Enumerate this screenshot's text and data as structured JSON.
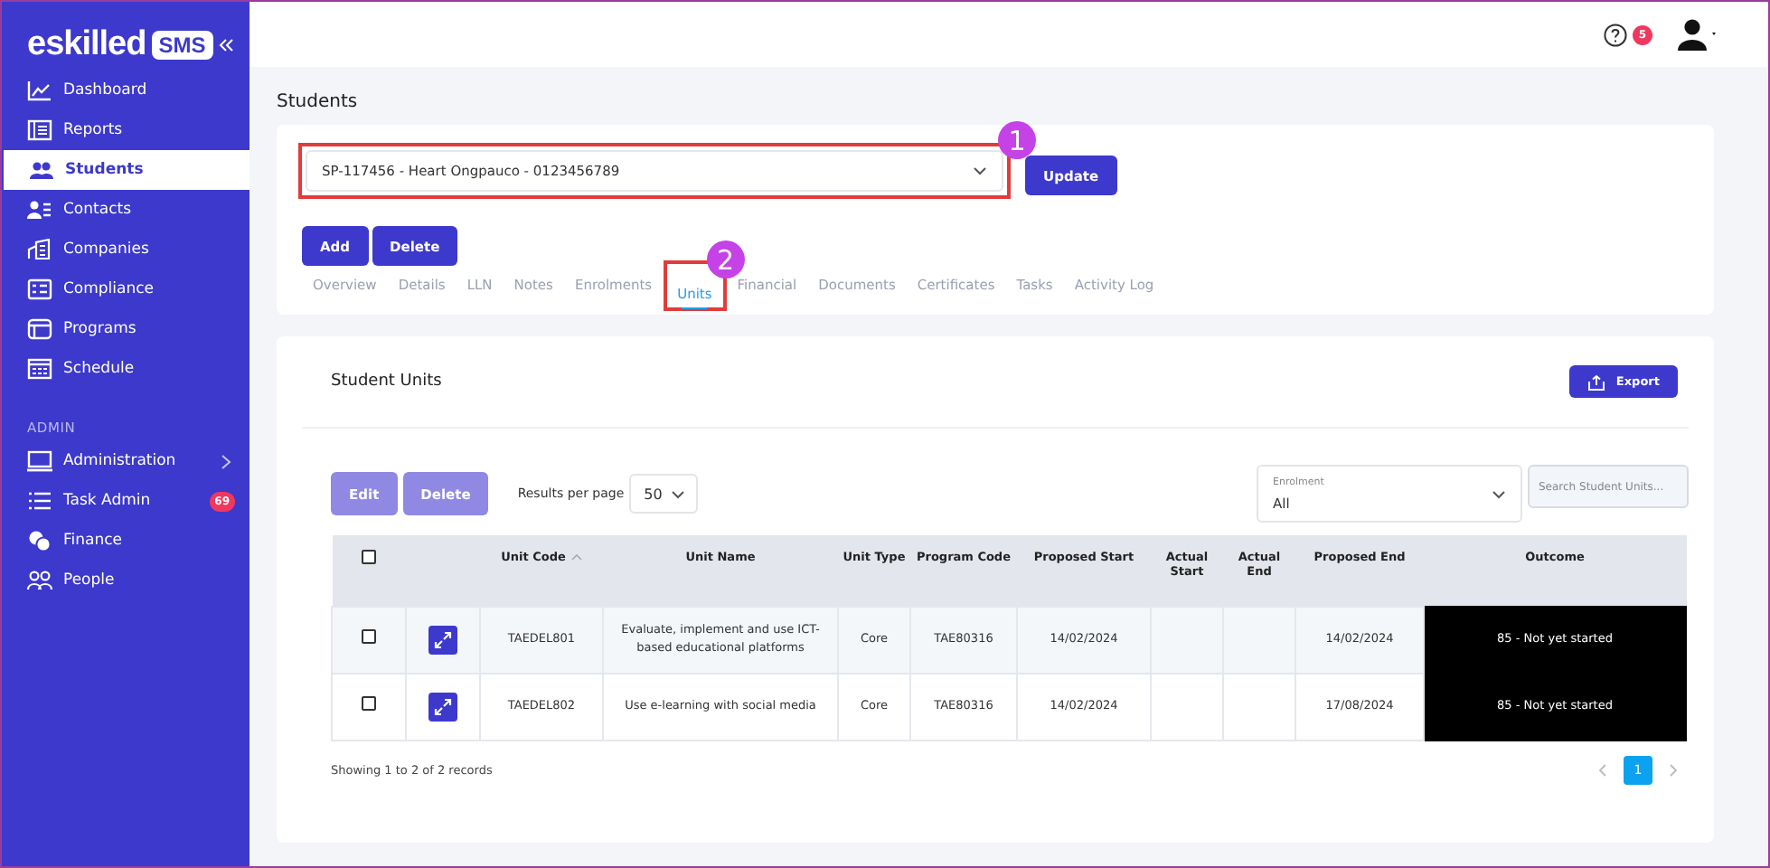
{
  "brand": {
    "name": "eskilled",
    "badge": "SMS"
  },
  "sidebar": {
    "items": [
      {
        "label": "Dashboard",
        "selected": false
      },
      {
        "label": "Reports",
        "selected": false
      },
      {
        "label": "Students",
        "selected": true
      },
      {
        "label": "Contacts",
        "selected": false
      },
      {
        "label": "Companies",
        "selected": false
      },
      {
        "label": "Compliance",
        "selected": false
      },
      {
        "label": "Programs",
        "selected": false
      },
      {
        "label": "Schedule",
        "selected": false
      }
    ],
    "section": "ADMIN",
    "admin_items": [
      {
        "label": "Administration",
        "selected": false,
        "submenu": true
      },
      {
        "label": "Task Admin",
        "selected": false,
        "submenu": false,
        "badge": "69"
      },
      {
        "label": "Finance",
        "selected": false,
        "submenu": false
      },
      {
        "label": "People",
        "selected": false,
        "submenu": false
      }
    ]
  },
  "topbar": {
    "notifications": "5"
  },
  "page_title": "Students",
  "student_selector": {
    "value": "SP-117456 - Heart Ongpauco - 0123456789",
    "callout": "1"
  },
  "update_button": "Update",
  "actions": [
    "Add",
    "Delete"
  ],
  "tabs": [
    {
      "label": "Overview",
      "selected": false
    },
    {
      "label": "Details",
      "selected": false
    },
    {
      "label": "LLN",
      "selected": false
    },
    {
      "label": "Notes",
      "selected": false
    },
    {
      "label": "Enrolments",
      "selected": false
    },
    {
      "label": "Units",
      "selected": true,
      "callout": "2"
    },
    {
      "label": "Financial",
      "selected": false
    },
    {
      "label": "Documents",
      "selected": false
    },
    {
      "label": "Certificates",
      "selected": false
    },
    {
      "label": "Tasks",
      "selected": false
    },
    {
      "label": "Activity Log",
      "selected": false
    }
  ],
  "units_panel": {
    "title": "Student Units",
    "export_button": "Export",
    "actions": [
      {
        "label": "Edit",
        "disabled": true
      },
      {
        "label": "Delete",
        "disabled": true
      }
    ],
    "results_per_page": {
      "label": "Results per page",
      "value": "50"
    },
    "enrolment_filter": {
      "label": "Enrolment",
      "value": "All"
    },
    "search": {
      "placeholder": "Search Student Units..."
    },
    "table": {
      "select_all": {
        "checked": false
      },
      "columns": [
        {
          "label": "Unit Code",
          "sorted": true
        },
        {
          "label": "Unit Name",
          "sorted": false
        },
        {
          "label": "Unit Type",
          "sorted": false
        },
        {
          "label": "Program Code",
          "sorted": false
        },
        {
          "label": "Proposed Start",
          "sorted": false
        },
        {
          "label": "Actual Start",
          "sorted": false
        },
        {
          "label": "Actual End",
          "sorted": false
        },
        {
          "label": "Proposed End",
          "sorted": false
        },
        {
          "label": "Outcome",
          "sorted": false
        }
      ],
      "rows": [
        {
          "checked": false,
          "unit_code": "TAEDEL801",
          "unit_name": "Evaluate, implement and use ICT-based educational platforms",
          "unit_type": "Core",
          "program_code": "TAE80316",
          "proposed_start": "14/02/2024",
          "proposed_end": "14/02/2024",
          "outcome": "85 - Not yet started"
        },
        {
          "checked": false,
          "unit_code": "TAEDEL802",
          "unit_name": "Use e-learning with social media",
          "unit_type": "Core",
          "program_code": "TAE80316",
          "proposed_start": "14/02/2024",
          "proposed_end": "17/08/2024",
          "outcome": "85 - Not yet started"
        }
      ]
    },
    "footer": "Showing 1 to 2 of 2 records",
    "pages": [
      {
        "label": "1",
        "selected": true
      }
    ]
  }
}
